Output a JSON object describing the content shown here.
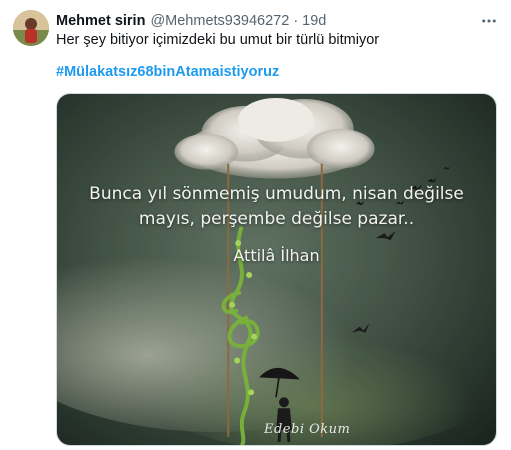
{
  "tweet": {
    "display_name": "Mehmet sirin",
    "handle": "@Mehmets93946272",
    "separator": "·",
    "time": "19d",
    "text": "Her şey bitiyor içimizdeki bu umut bir türlü bitmiyor",
    "hashtag": "#Mülakatsız68binAtamaistiyoruz",
    "more_icon": "more-horizontal-icon"
  },
  "media": {
    "quote_line1": "Bunca yıl sönmemiş umudum, nisan değilse",
    "quote_line2": "mayıs, perşembe değilse pazar..",
    "author": "Attilâ İlhan",
    "signature": "Edebi Okum"
  },
  "colors": {
    "hashtag": "#1d9bf0",
    "secondary_text": "#536471",
    "border": "#cfd9de"
  }
}
